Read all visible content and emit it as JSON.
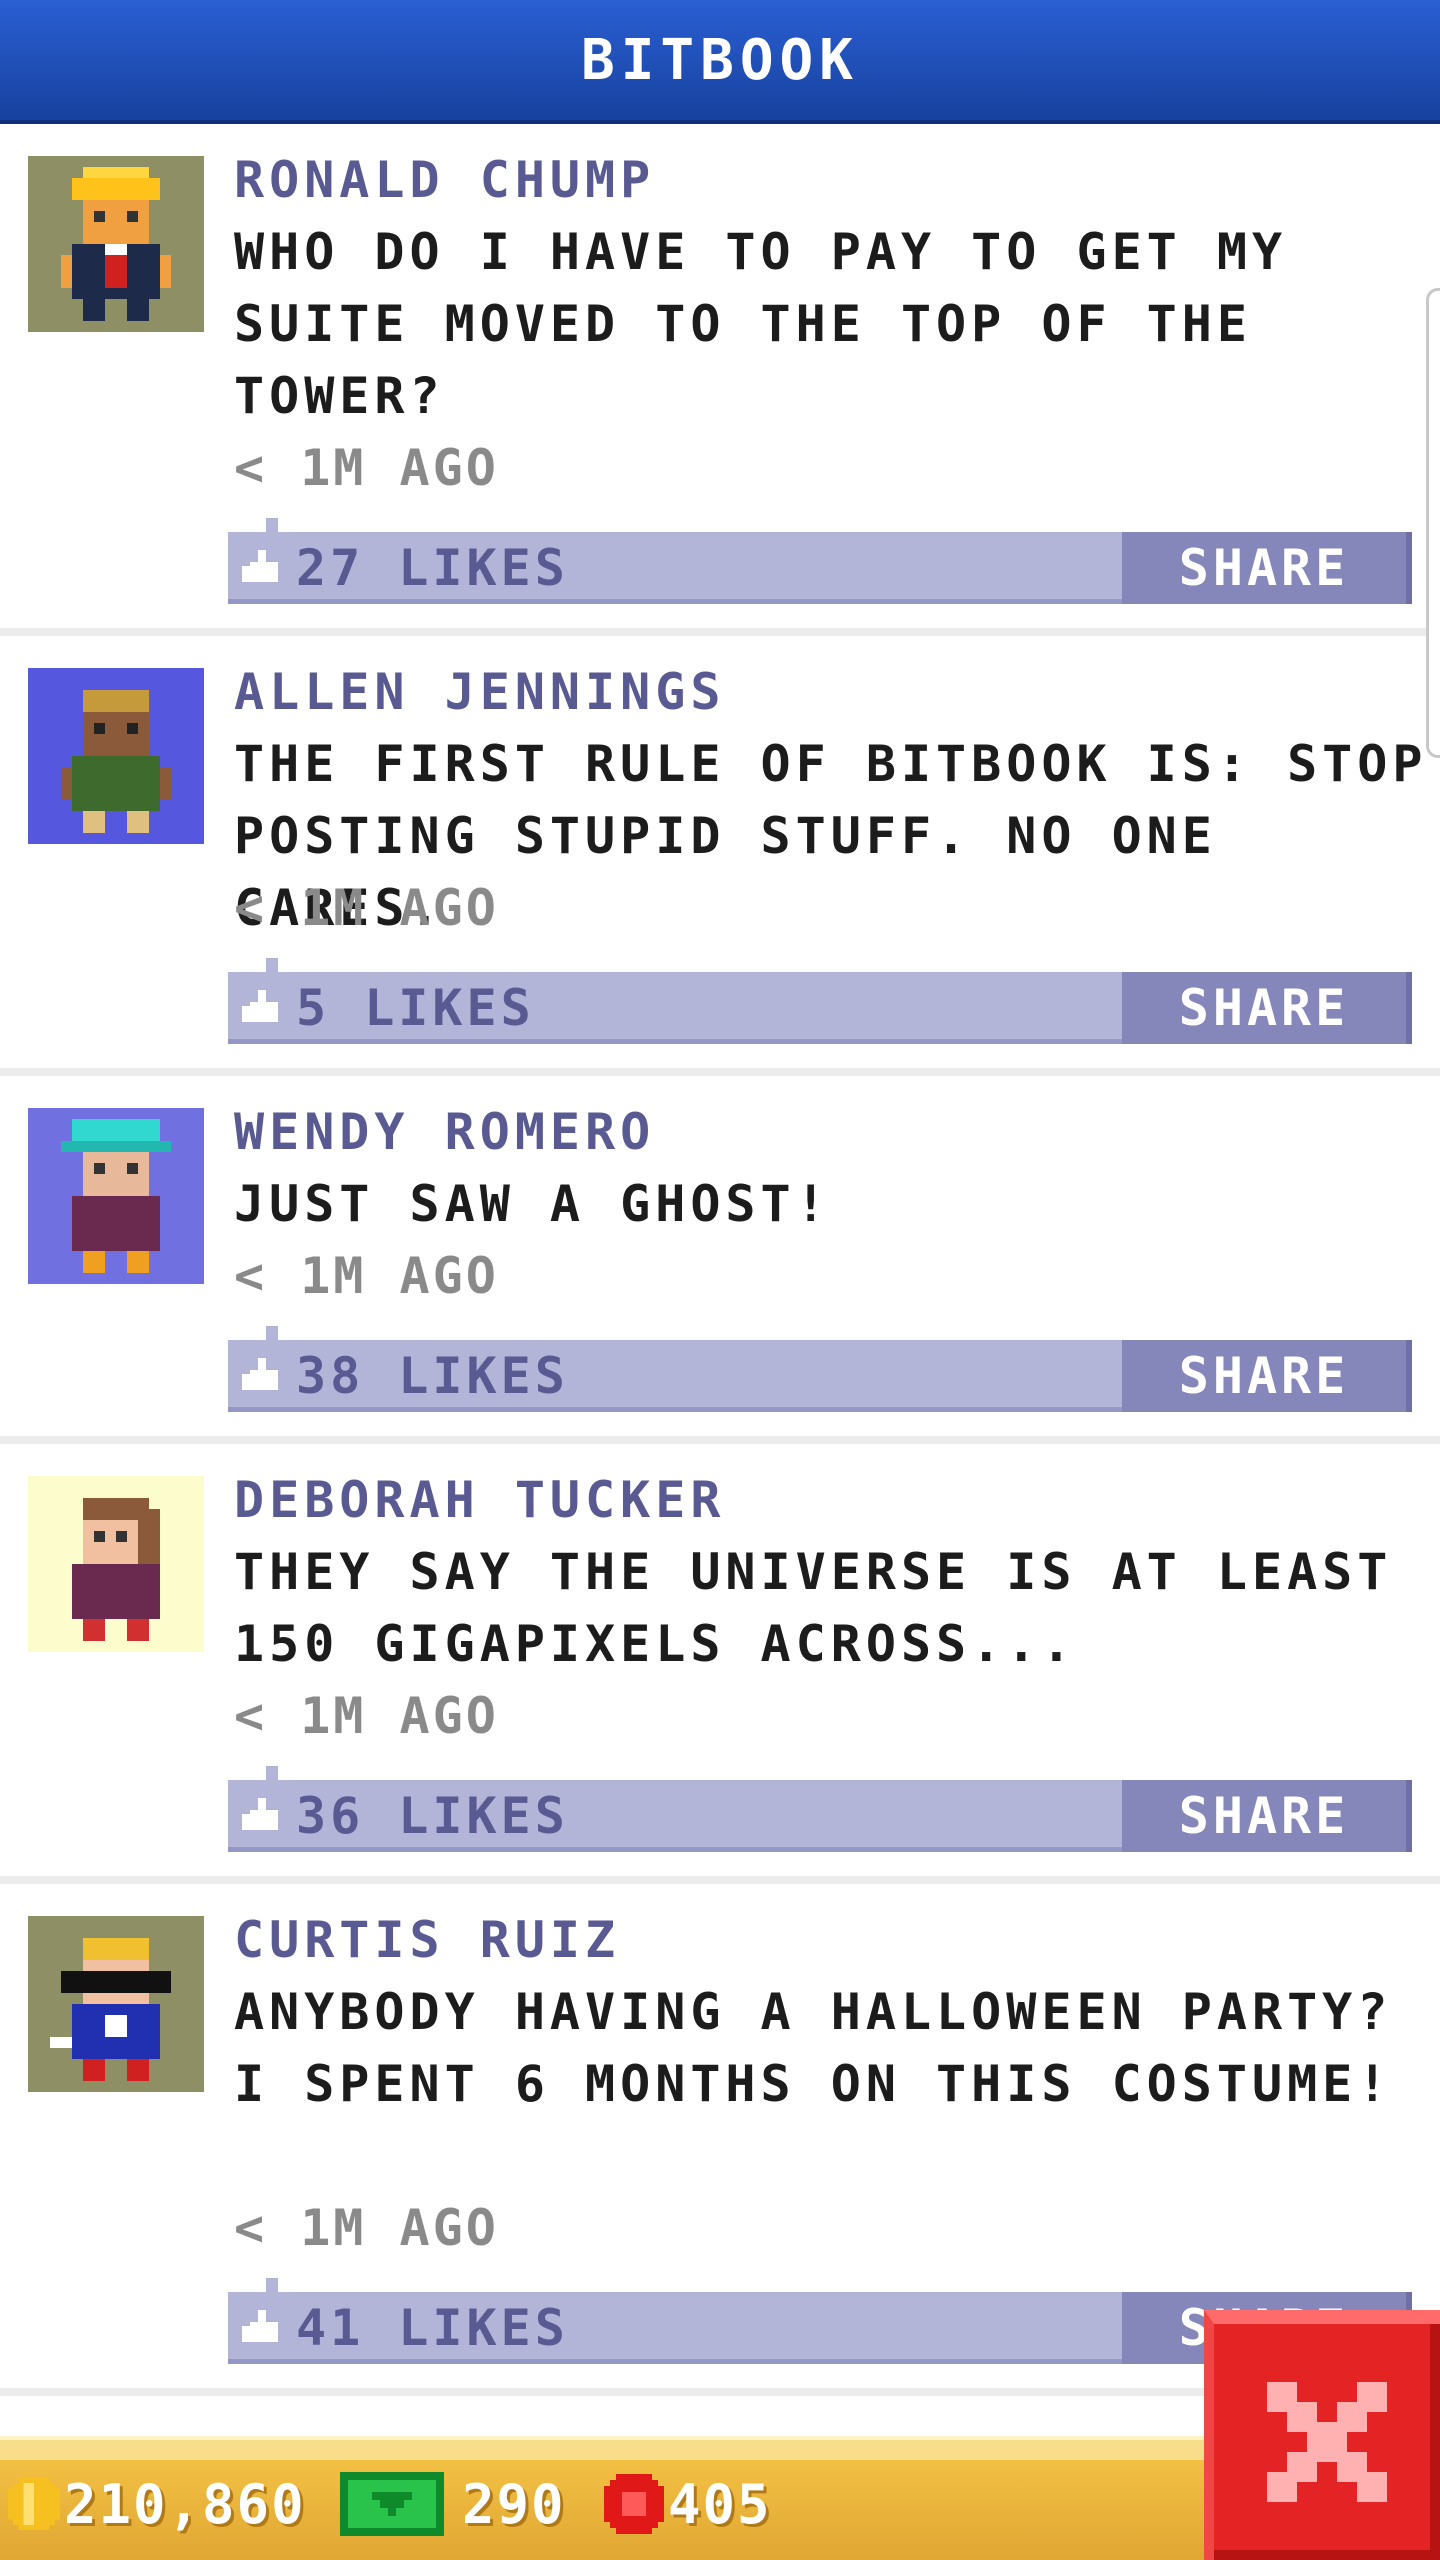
{
  "app": {
    "title": "BITBOOK"
  },
  "colors": {
    "header": "#1f4fbf",
    "like_bar": "#b2b4d8",
    "share": "#8587bb",
    "name": "#5a5a92",
    "close": "#e42424"
  },
  "posts": [
    {
      "name": "RONALD CHUMP",
      "message": "WHO DO I HAVE TO PAY TO GET MY SUITE MOVED TO THE TOP OF THE TOWER?",
      "time": "< 1M AGO",
      "likes": "27 LIKES",
      "share": "SHARE",
      "avatar_bg": "#8f8f65",
      "avatar_icon": "pixel-person-blonde-suit"
    },
    {
      "name": "ALLEN JENNINGS",
      "message": "THE FIRST RULE OF BITBOOK IS: STOP POSTING STUPID STUFF. NO ONE CARES.",
      "time": "< 1M AGO",
      "likes": "5 LIKES",
      "share": "SHARE",
      "avatar_bg": "#5558de",
      "avatar_icon": "pixel-person-green-coat"
    },
    {
      "name": "WENDY ROMERO",
      "message": "JUST SAW A GHOST!",
      "time": "< 1M AGO",
      "likes": "38 LIKES",
      "share": "SHARE",
      "avatar_bg": "#7070e0",
      "avatar_icon": "pixel-person-teal-hat"
    },
    {
      "name": "DEBORAH TUCKER",
      "message": "THEY SAY THE UNIVERSE IS AT LEAST 150 GIGAPIXELS ACROSS...",
      "time": "< 1M AGO",
      "likes": "36 LIKES",
      "share": "SHARE",
      "avatar_bg": "#fdfccc",
      "avatar_icon": "pixel-person-brown-hair"
    },
    {
      "name": "CURTIS RUIZ",
      "message": "ANYBODY HAVING A HALLOWEEN PARTY? I SPENT 6 MONTHS ON THIS COSTUME!",
      "time": "< 1M AGO",
      "likes": "41 LIKES",
      "share": "SHARE",
      "avatar_bg": "#8f8f65",
      "avatar_icon": "pixel-person-sunglasses"
    }
  ],
  "resources": {
    "coins": "210,860",
    "bux": "290",
    "tokens": "405"
  },
  "close_icon": "close-x-icon"
}
